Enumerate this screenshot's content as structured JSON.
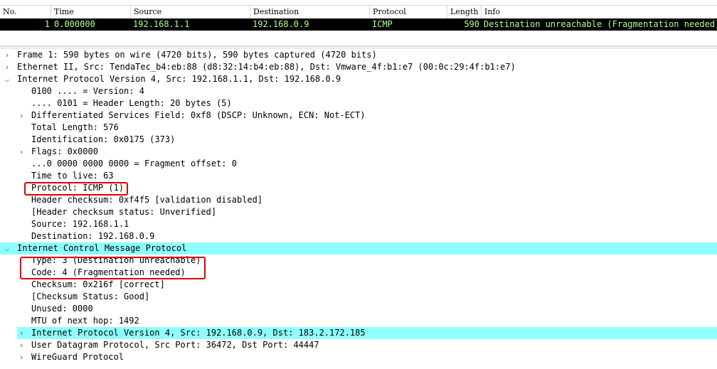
{
  "packet_list": {
    "columns": [
      "No.",
      "Time",
      "Source",
      "Destination",
      "Protocol",
      "Length",
      "Info"
    ],
    "rows": [
      {
        "no": "1",
        "time": "0.000000",
        "source": "192.168.1.1",
        "destination": "192.168.0.9",
        "protocol": "ICMP",
        "length": "590",
        "info": "Destination unreachable (Fragmentation needed)"
      }
    ]
  },
  "details": [
    {
      "text": "Frame 1: 590 bytes on wire (4720 bits), 590 bytes captured (4720 bits)",
      "expander": "collapsed",
      "highlight": false
    },
    {
      "text": "Ethernet II, Src: TendaTec_b4:eb:88 (d8:32:14:b4:eb:88), Dst: Vmware_4f:b1:e7 (00:0c:29:4f:b1:e7)",
      "expander": "collapsed",
      "highlight": false
    },
    {
      "text": "Internet Protocol Version 4, Src: 192.168.1.1, Dst: 192.168.0.9",
      "expander": "expanded",
      "highlight": false
    },
    {
      "text": "0100 .... = Version: 4",
      "expander": "none",
      "highlight": false
    },
    {
      "text": ".... 0101 = Header Length: 20 bytes (5)",
      "expander": "none",
      "highlight": false
    },
    {
      "text": "Differentiated Services Field: 0xf8 (DSCP: Unknown, ECN: Not-ECT)",
      "expander": "collapsed",
      "highlight": false
    },
    {
      "text": "Total Length: 576",
      "expander": "none",
      "highlight": false
    },
    {
      "text": "Identification: 0x0175 (373)",
      "expander": "none",
      "highlight": false
    },
    {
      "text": "Flags: 0x0000",
      "expander": "collapsed",
      "highlight": false
    },
    {
      "text": "...0 0000 0000 0000 = Fragment offset: 0",
      "expander": "none",
      "highlight": false
    },
    {
      "text": "Time to live: 63",
      "expander": "none",
      "highlight": false
    },
    {
      "text": "Protocol: ICMP (1)",
      "expander": "none",
      "highlight": false
    },
    {
      "text": "Header checksum: 0xf4f5 [validation disabled]",
      "expander": "none",
      "highlight": false
    },
    {
      "text": "[Header checksum status: Unverified]",
      "expander": "none",
      "highlight": false
    },
    {
      "text": "Source: 192.168.1.1",
      "expander": "none",
      "highlight": false
    },
    {
      "text": "Destination: 192.168.0.9",
      "expander": "none",
      "highlight": false
    },
    {
      "text": "Internet Control Message Protocol",
      "expander": "expanded",
      "highlight": true
    },
    {
      "text": "Type: 3 (Destination unreachable)",
      "expander": "none",
      "highlight": false
    },
    {
      "text": "Code: 4 (Fragmentation needed)",
      "expander": "none",
      "highlight": false
    },
    {
      "text": "Checksum: 0x216f [correct]",
      "expander": "none",
      "highlight": false
    },
    {
      "text": "[Checksum Status: Good]",
      "expander": "none",
      "highlight": false
    },
    {
      "text": "Unused: 0000",
      "expander": "none",
      "highlight": false
    },
    {
      "text": "MTU of next hop: 1492",
      "expander": "none",
      "highlight": false
    },
    {
      "text": "Internet Protocol Version 4, Src: 192.168.0.9, Dst: 183.2.172.185",
      "expander": "collapsed",
      "highlight": true
    },
    {
      "text": "User Datagram Protocol, Src Port: 36472, Dst Port: 44447",
      "expander": "collapsed",
      "highlight": false
    },
    {
      "text": "WireGuard Protocol",
      "expander": "collapsed",
      "highlight": false
    }
  ],
  "colors": {
    "selected_row_bg": "#000000",
    "selected_row_fg": "#b6ff8c",
    "highlight_bg": "#8fffff",
    "annotation_box": "#e00000"
  }
}
